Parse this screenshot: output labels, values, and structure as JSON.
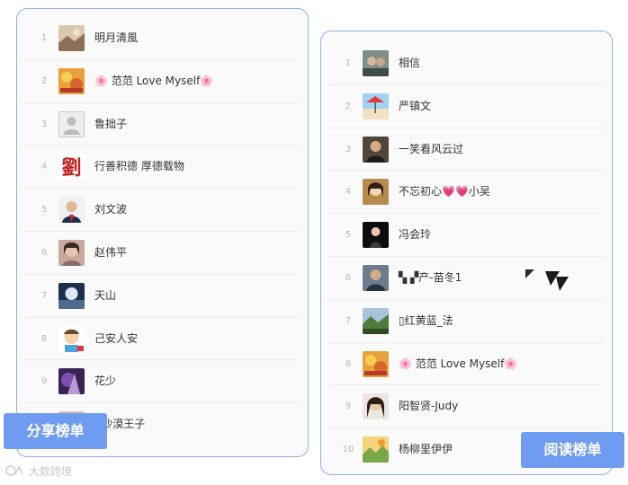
{
  "share_ranking": {
    "tag_label": "分享榜单",
    "rows": [
      {
        "rank": "1",
        "name": "明月清風",
        "avatar": "landscape-avatar-icon"
      },
      {
        "rank": "2",
        "name": "🌸 范范   Love Myself🌸",
        "avatar": "food-avatar-icon"
      },
      {
        "rank": "3",
        "name": "鲁拙子",
        "avatar": "default-user-avatar-icon"
      },
      {
        "rank": "4",
        "name": "行善积德   厚德载物",
        "avatar": "calligraphy-avatar-icon"
      },
      {
        "rank": "5",
        "name": "刘文波",
        "avatar": "portrait-avatar-icon"
      },
      {
        "rank": "6",
        "name": "赵伟平",
        "avatar": "portrait-avatar-icon"
      },
      {
        "rank": "7",
        "name": "天山",
        "avatar": "moon-avatar-icon"
      },
      {
        "rank": "8",
        "name": "己安人安",
        "avatar": "cartoon-avatar-icon"
      },
      {
        "rank": "9",
        "name": "花少",
        "avatar": "purple-avatar-icon"
      },
      {
        "rank": "10",
        "name": "A沙漠王子",
        "avatar": "portrait-avatar-icon"
      }
    ]
  },
  "read_ranking": {
    "tag_label": "阅读榜单",
    "rows": [
      {
        "rank": "1",
        "name": "相信",
        "avatar": "portrait-avatar-icon"
      },
      {
        "rank": "2",
        "name": "严镇文",
        "avatar": "beach-avatar-icon"
      },
      {
        "rank": "3",
        "name": "一笑看风云过",
        "avatar": "portrait-avatar-icon"
      },
      {
        "rank": "4",
        "name": "不忘初心💗💗小吴",
        "avatar": "portrait-avatar-icon"
      },
      {
        "rank": "5",
        "name": "冯会玲",
        "avatar": "dark-avatar-icon"
      },
      {
        "rank": "6",
        "name": "▚  ▞产-苗冬1",
        "avatar": "portrait-avatar-icon"
      },
      {
        "rank": "7",
        "name": "▯红黄蓝_法",
        "avatar": "landscape-avatar-icon"
      },
      {
        "rank": "8",
        "name": "🌸 范范   Love Myself🌸",
        "avatar": "food-avatar-icon"
      },
      {
        "rank": "9",
        "name": "阳智贤-Judy",
        "avatar": "portrait-avatar-icon"
      },
      {
        "rank": "10",
        "name": "杨柳里伊伊",
        "avatar": "landscape-avatar-icon"
      }
    ]
  },
  "watermark": "大数跨境",
  "colors": {
    "accent": "#6f9cf1",
    "border": "#8fb0ec"
  }
}
